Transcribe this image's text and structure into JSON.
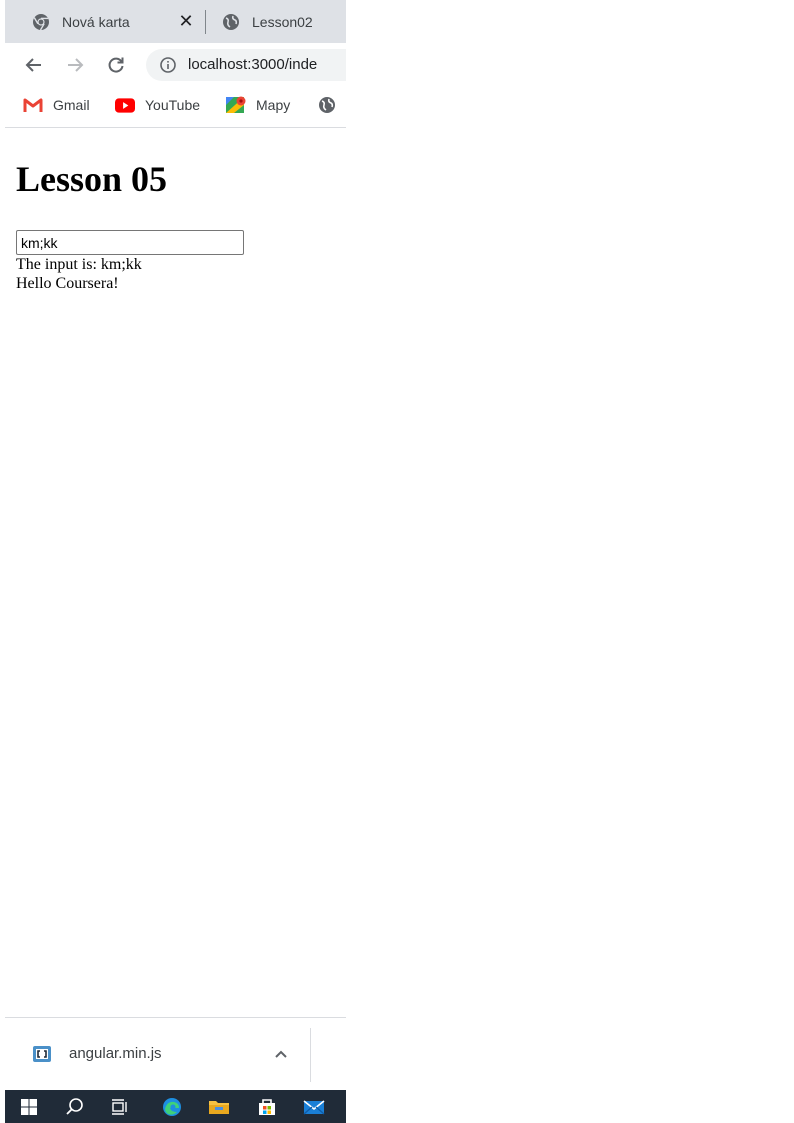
{
  "tabs": [
    {
      "label": "Nová karta",
      "icon": "chrome-icon"
    },
    {
      "label": "Lesson02",
      "icon": "globe-icon"
    }
  ],
  "toolbar": {
    "url": "localhost:3000/inde"
  },
  "bookmarks": [
    {
      "label": "Gmail",
      "icon": "gmail-icon"
    },
    {
      "label": "YouTube",
      "icon": "youtube-icon"
    },
    {
      "label": "Mapy",
      "icon": "maps-icon"
    }
  ],
  "page": {
    "heading": "Lesson 05",
    "input_value": "km;kk",
    "output_line": "The input is: km;kk",
    "greeting": "Hello Coursera!"
  },
  "download": {
    "filename": "angular.min.js"
  },
  "colors": {
    "tabstrip": "#dee1e6",
    "omnibox": "#f1f3f4",
    "taskbar": "#202b38",
    "youtube": "#ff0000",
    "gmail": "#ea4335"
  }
}
